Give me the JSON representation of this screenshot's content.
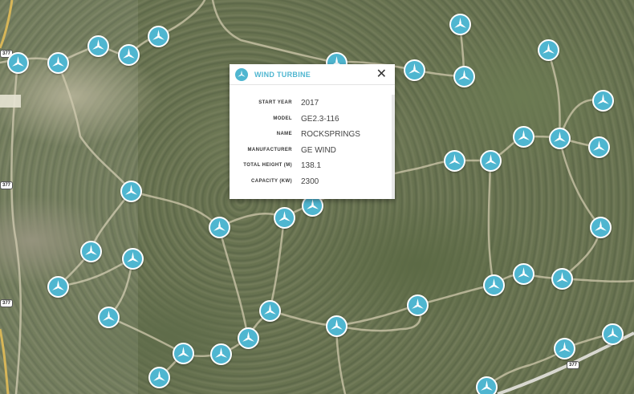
{
  "map": {
    "highway_signs": [
      "377",
      "377",
      "377",
      "377"
    ]
  },
  "turbine_icon": "wind-turbine-icon",
  "accent_color": "#4fb6d0",
  "popup": {
    "title": "WIND TURBINE",
    "close_label": "✕",
    "fields": [
      {
        "label": "START YEAR",
        "value": "2017"
      },
      {
        "label": "MODEL",
        "value": "GE2.3-116"
      },
      {
        "label": "NAME",
        "value": "ROCKSPRINGS"
      },
      {
        "label": "MANUFACTURER",
        "value": "GE WIND"
      },
      {
        "label": "TOTAL HEIGHT (M)",
        "value": "138.1"
      },
      {
        "label": "CAPACITY (KW)",
        "value": "2300"
      }
    ]
  }
}
